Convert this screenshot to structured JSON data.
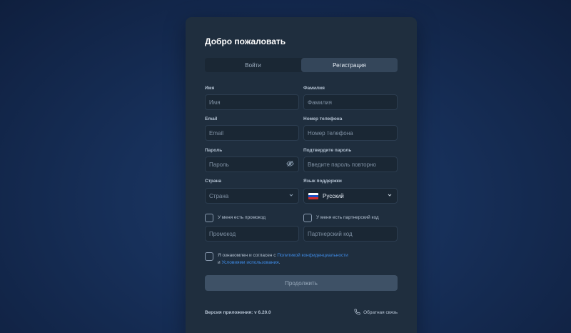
{
  "card": {
    "title": "Добро пожаловать"
  },
  "tabs": [
    {
      "label": "Войти",
      "active": false
    },
    {
      "label": "Регистрация",
      "active": true
    }
  ],
  "fields": {
    "first_name": {
      "label": "Имя",
      "placeholder": "Имя"
    },
    "last_name": {
      "label": "Фамилия",
      "placeholder": "Фамилия"
    },
    "email": {
      "label": "Email",
      "placeholder": "Email"
    },
    "phone": {
      "label": "Номер телефона",
      "placeholder": "Номер телефона"
    },
    "password": {
      "label": "Пароль",
      "placeholder": "Пароль",
      "icon": "eye-off-icon"
    },
    "password_confirm": {
      "label": "Подтвердите пароль",
      "placeholder": "Введите пароль повторно"
    },
    "country": {
      "label": "Страна",
      "placeholder": "Страна",
      "icon": "chevron-down-icon"
    },
    "support_language": {
      "label": "Язык поддержки",
      "value": "Русский",
      "icon": "chevron-down-icon"
    },
    "promo": {
      "checkbox_label": "У меня есть промокод",
      "placeholder": "Промокод",
      "checked": false
    },
    "partner": {
      "checkbox_label": "У меня есть партнерский код",
      "placeholder": "Партнерский код",
      "checked": false
    }
  },
  "consent": {
    "prefix": "Я ознакомлен и согласен с ",
    "privacy_link": "Политикой конфиденциальности",
    "middle": "и ",
    "terms_link": "Условиями использования",
    "suffix": ".",
    "checked": false
  },
  "submit_label": "Продолжить",
  "footer": {
    "version": "Версия приложения: v 6.20.0",
    "feedback": "Обратная связь",
    "feedback_icon": "phone-icon"
  },
  "colors": {
    "card_bg": "#1f2e3e",
    "input_bg": "#1a2734",
    "link": "#3f8ce8",
    "submit_bg": "#3e5166"
  }
}
